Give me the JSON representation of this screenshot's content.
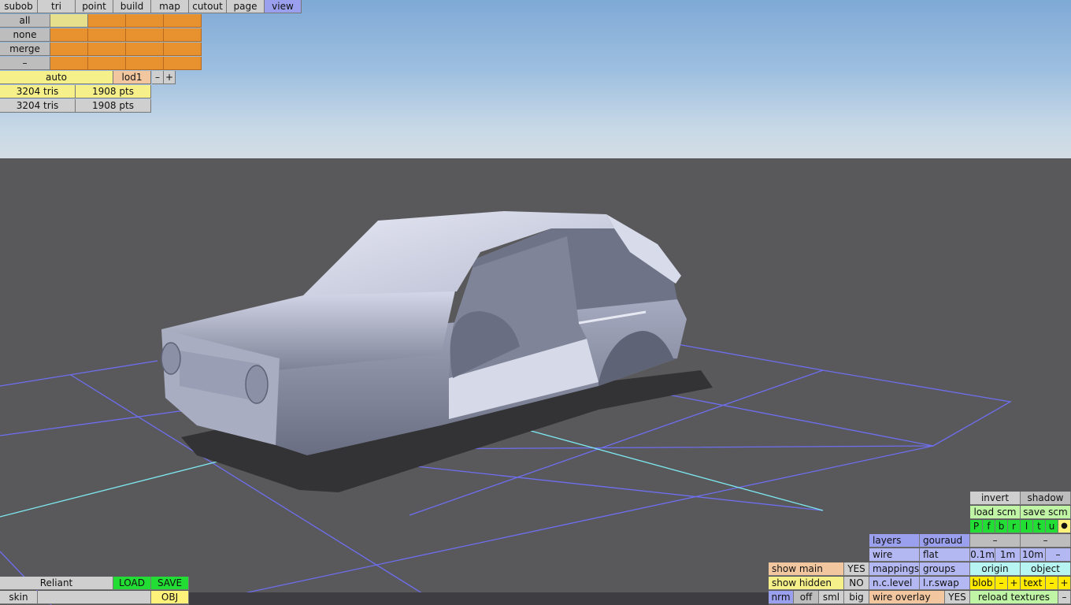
{
  "menu": {
    "tabs": [
      "subob",
      "tri",
      "point",
      "build",
      "map",
      "cutout",
      "page",
      "view"
    ],
    "active": "view"
  },
  "selection": {
    "all": "all",
    "none": "none",
    "merge": "merge",
    "minus": "–"
  },
  "lod": {
    "mode": "auto",
    "level": "lod1",
    "dec": "–",
    "inc": "+"
  },
  "stats": {
    "row1_tris": "3204 tris",
    "row1_pts": "1908 pts",
    "row2_tris": "3204 tris",
    "row2_pts": "1908 pts"
  },
  "bottom_left": {
    "name": "Reliant",
    "load": "LOAD",
    "save": "SAVE",
    "skin": "skin",
    "format": "OBJ"
  },
  "display": {
    "show_main": "show main",
    "show_main_value": "YES",
    "show_hidden": "show hidden",
    "show_hidden_value": "NO",
    "nrm": "nrm",
    "off": "off",
    "sml": "sml",
    "big": "big"
  },
  "render": {
    "layers": "layers",
    "gouraud": "gouraud",
    "wire": "wire",
    "flat": "flat",
    "mappings": "mappings",
    "groups": "groups",
    "nclevel": "n.c.level",
    "lrswap": "l.r.swap",
    "wire_overlay": "wire overlay",
    "wire_overlay_value": "YES"
  },
  "right_panel": {
    "invert": "invert",
    "shadow": "shadow",
    "load_scm": "load scm",
    "save_scm": "save scm",
    "layer_toggles": [
      "P",
      "f",
      "b",
      "r",
      "l",
      "t",
      "u"
    ],
    "dot": "●",
    "minus1": "–",
    "minus2": "–",
    "grid_01": "0.1m",
    "grid_1": "1m",
    "grid_10": "10m",
    "grid_minus": "–",
    "origin": "origin",
    "object": "object",
    "blob": "blob",
    "blob_dec": "–",
    "blob_inc": "+",
    "text": "text",
    "text_dec": "–",
    "text_inc": "+",
    "reload_textures": "reload textures",
    "reload_minus": "–"
  },
  "colors": {
    "sky_top": "#7fa9d6",
    "ground": "#59595c",
    "grid_line": "#6e6ef0",
    "axis_line": "#7ee8f0",
    "car_body": "#c9cde0"
  }
}
